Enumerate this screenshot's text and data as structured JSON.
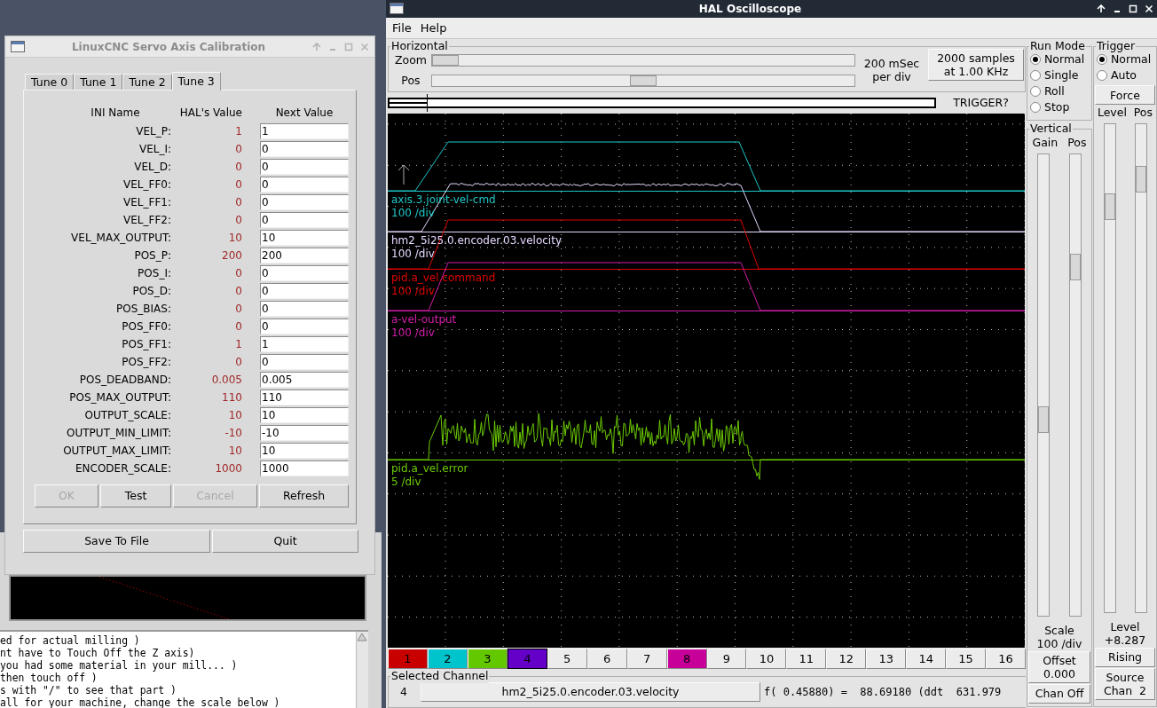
{
  "background_window": {
    "log_lines": [
      "ed for actual milling )",
      "nt have to Touch Off the Z axis)",
      "you had some material in your mill... )",
      "then touch off )",
      "s with \"/\" to see that part )",
      "all for your machine, change the scale below )"
    ]
  },
  "calibration": {
    "title": "LinuxCNC Servo Axis Calibration",
    "tabs": [
      {
        "label": "Tune 0",
        "selected": false
      },
      {
        "label": "Tune 1",
        "selected": false
      },
      {
        "label": "Tune 2",
        "selected": false
      },
      {
        "label": "Tune 3",
        "selected": true
      }
    ],
    "columns": [
      "INI Name",
      "HAL's Value",
      "Next Value"
    ],
    "rows": [
      {
        "name": "VEL_P:",
        "hal_value": "1",
        "next_value": "1"
      },
      {
        "name": "VEL_I:",
        "hal_value": "0",
        "next_value": "0"
      },
      {
        "name": "VEL_D:",
        "hal_value": "0",
        "next_value": "0"
      },
      {
        "name": "VEL_FF0:",
        "hal_value": "0",
        "next_value": "0"
      },
      {
        "name": "VEL_FF1:",
        "hal_value": "0",
        "next_value": "0"
      },
      {
        "name": "VEL_FF2:",
        "hal_value": "0",
        "next_value": "0"
      },
      {
        "name": "VEL_MAX_OUTPUT:",
        "hal_value": "10",
        "next_value": "10"
      },
      {
        "name": "POS_P:",
        "hal_value": "200",
        "next_value": "200"
      },
      {
        "name": "POS_I:",
        "hal_value": "0",
        "next_value": "0"
      },
      {
        "name": "POS_D:",
        "hal_value": "0",
        "next_value": "0"
      },
      {
        "name": "POS_BIAS:",
        "hal_value": "0",
        "next_value": "0"
      },
      {
        "name": "POS_FF0:",
        "hal_value": "0",
        "next_value": "0"
      },
      {
        "name": "POS_FF1:",
        "hal_value": "1",
        "next_value": "1"
      },
      {
        "name": "POS_FF2:",
        "hal_value": "0",
        "next_value": "0"
      },
      {
        "name": "POS_DEADBAND:",
        "hal_value": "0.005",
        "next_value": "0.005"
      },
      {
        "name": "POS_MAX_OUTPUT:",
        "hal_value": "110",
        "next_value": "110"
      },
      {
        "name": "OUTPUT_SCALE:",
        "hal_value": "10",
        "next_value": "10"
      },
      {
        "name": "OUTPUT_MIN_LIMIT:",
        "hal_value": "-10",
        "next_value": "-10"
      },
      {
        "name": "OUTPUT_MAX_LIMIT:",
        "hal_value": "10",
        "next_value": "10"
      },
      {
        "name": "ENCODER_SCALE:",
        "hal_value": "1000",
        "next_value": "1000"
      }
    ],
    "buttons": [
      {
        "label": "OK",
        "disabled": true
      },
      {
        "label": "Test",
        "disabled": false
      },
      {
        "label": "Cancel",
        "disabled": true
      },
      {
        "label": "Refresh",
        "disabled": false
      }
    ],
    "footer_buttons": [
      "Save To File",
      "Quit"
    ]
  },
  "scope": {
    "title": "HAL Oscilloscope",
    "menu": [
      "File",
      "Help"
    ],
    "horizontal": {
      "title": "Horizontal",
      "sliders": [
        {
          "label": "Zoom",
          "level": 0
        },
        {
          "label": "Pos",
          "level": 0.5
        }
      ],
      "rate_lines": [
        "200 mSec",
        "per div"
      ],
      "samples_button": [
        "2000 samples",
        "at 1.00 KHz"
      ],
      "trigger_status": "TRIGGER?"
    },
    "traces": [
      {
        "name": "axis.3.joint-vel-cmd",
        "scale": "100 /div",
        "color": "#1fc8c8",
        "kind": "ramp"
      },
      {
        "name": "hm2_5i25.0.encoder.03.velocity",
        "scale": "100 /div",
        "color": "#e6d8ff",
        "kind": "noisy-ramp"
      },
      {
        "name": "pid.a_vel.command",
        "scale": "100 /div",
        "color": "#e00000",
        "kind": "ramp"
      },
      {
        "name": "a-vel-output",
        "scale": "100 /div",
        "color": "#d21eaa",
        "kind": "ramp"
      },
      {
        "name": "pid.a_vel.error",
        "scale": "5 /div",
        "color": "#6ccc00",
        "kind": "noise"
      }
    ],
    "channels": [
      {
        "label": "1",
        "color": "#c80000",
        "selected": false
      },
      {
        "label": "2",
        "color": "#00c4cc",
        "selected": false
      },
      {
        "label": "3",
        "color": "#64c800",
        "selected": false
      },
      {
        "label": "4",
        "color": "#6400c8",
        "selected": true
      },
      {
        "label": "5",
        "selected": false
      },
      {
        "label": "6",
        "selected": false
      },
      {
        "label": "7",
        "selected": false
      },
      {
        "label": "8",
        "color": "#c8009a",
        "selected": false
      },
      {
        "label": "9",
        "selected": false
      },
      {
        "label": "10",
        "selected": false
      },
      {
        "label": "11",
        "selected": false
      },
      {
        "label": "12",
        "selected": false
      },
      {
        "label": "13",
        "selected": false
      },
      {
        "label": "14",
        "selected": false
      },
      {
        "label": "15",
        "selected": false
      },
      {
        "label": "16",
        "selected": false
      }
    ],
    "selected_channel": {
      "title": "Selected Channel",
      "number": "4",
      "name": "hm2_5i25.0.encoder.03.velocity",
      "readout": "f( 0.45880) =  88.69180 (ddt  631.979"
    },
    "run_mode": {
      "title": "Run Mode",
      "options": [
        {
          "label": "Normal",
          "selected": true
        },
        {
          "label": "Single",
          "selected": false
        },
        {
          "label": "Roll",
          "selected": false
        },
        {
          "label": "Stop",
          "selected": false
        }
      ]
    },
    "vertical": {
      "title": "Vertical",
      "sliders": [
        {
          "label": "Gain",
          "level": 0.42
        },
        {
          "label": "Pos",
          "level": 0.77
        }
      ],
      "scale_label": "Scale",
      "scale_value": "100 /div",
      "offset_button": [
        "Offset",
        "0.000"
      ],
      "chan_off_button": "Chan Off"
    },
    "trigger": {
      "title": "Trigger",
      "options": [
        {
          "label": "Normal",
          "selected": true
        },
        {
          "label": "Auto",
          "selected": false
        }
      ],
      "force_button": "Force",
      "sliders": [
        {
          "label": "Level",
          "level": 0.85
        },
        {
          "label": "Pos",
          "level": 0.91
        }
      ],
      "level_label": "Level",
      "level_value": "+8.287",
      "edge_button": "Rising",
      "source_button": [
        "Source",
        "Chan  2"
      ]
    }
  }
}
